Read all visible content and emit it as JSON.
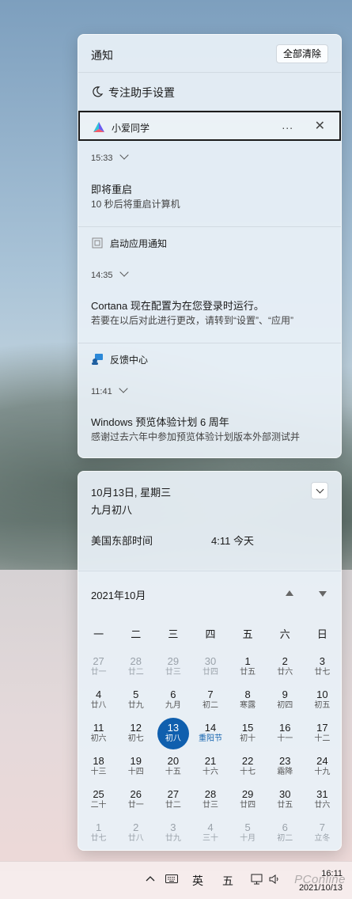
{
  "notification_center": {
    "title": "通知",
    "clear_all": "全部清除",
    "focus_assist": "专注助手设置",
    "groups": [
      {
        "app": "小爱同学",
        "time": "15:33",
        "title": "即将重启",
        "body": "10 秒后将重启计算机"
      },
      {
        "app": "启动应用通知",
        "time": "14:35",
        "title": "Cortana 现在配置为在您登录时运行。",
        "body": "若要在以后对此进行更改，请转到“设置”、“应用”"
      },
      {
        "app": "反馈中心",
        "time": "11:41",
        "title": "Windows 预览体验计划 6 周年",
        "body": "感谢过去六年中参加预览体验计划版本外部测试并"
      }
    ],
    "more_icon": "...",
    "close_icon": "✕"
  },
  "calendar": {
    "date_line": "10月13日, 星期三",
    "lunar_line": "九月初八",
    "tz_name": "美国东部时间",
    "tz_time": "4:11 今天",
    "month_label": "2021年10月",
    "weekdays": [
      "一",
      "二",
      "三",
      "四",
      "五",
      "六",
      "日"
    ],
    "days": [
      {
        "d": "27",
        "l": "廿一",
        "dim": true
      },
      {
        "d": "28",
        "l": "廿二",
        "dim": true
      },
      {
        "d": "29",
        "l": "廿三",
        "dim": true
      },
      {
        "d": "30",
        "l": "廿四",
        "dim": true
      },
      {
        "d": "1",
        "l": "廿五"
      },
      {
        "d": "2",
        "l": "廿六"
      },
      {
        "d": "3",
        "l": "廿七"
      },
      {
        "d": "4",
        "l": "廿八"
      },
      {
        "d": "5",
        "l": "廿九"
      },
      {
        "d": "6",
        "l": "九月"
      },
      {
        "d": "7",
        "l": "初二"
      },
      {
        "d": "8",
        "l": "寒露"
      },
      {
        "d": "9",
        "l": "初四"
      },
      {
        "d": "10",
        "l": "初五"
      },
      {
        "d": "11",
        "l": "初六"
      },
      {
        "d": "12",
        "l": "初七"
      },
      {
        "d": "13",
        "l": "初八",
        "today": true
      },
      {
        "d": "14",
        "l": "重阳节",
        "fest": true
      },
      {
        "d": "15",
        "l": "初十"
      },
      {
        "d": "16",
        "l": "十一"
      },
      {
        "d": "17",
        "l": "十二"
      },
      {
        "d": "18",
        "l": "十三"
      },
      {
        "d": "19",
        "l": "十四"
      },
      {
        "d": "20",
        "l": "十五"
      },
      {
        "d": "21",
        "l": "十六"
      },
      {
        "d": "22",
        "l": "十七"
      },
      {
        "d": "23",
        "l": "霜降"
      },
      {
        "d": "24",
        "l": "十九"
      },
      {
        "d": "25",
        "l": "二十"
      },
      {
        "d": "26",
        "l": "廿一"
      },
      {
        "d": "27",
        "l": "廿二"
      },
      {
        "d": "28",
        "l": "廿三"
      },
      {
        "d": "29",
        "l": "廿四"
      },
      {
        "d": "30",
        "l": "廿五"
      },
      {
        "d": "31",
        "l": "廿六"
      },
      {
        "d": "1",
        "l": "廿七",
        "dim": true
      },
      {
        "d": "2",
        "l": "廿八",
        "dim": true
      },
      {
        "d": "3",
        "l": "廿九",
        "dim": true
      },
      {
        "d": "4",
        "l": "三十",
        "dim": true
      },
      {
        "d": "5",
        "l": "十月",
        "dim": true
      },
      {
        "d": "6",
        "l": "初二",
        "dim": true
      },
      {
        "d": "7",
        "l": "立冬",
        "dim": true
      }
    ]
  },
  "taskbar": {
    "ime_lang": "英",
    "ime_mode": "五",
    "time": "16:11",
    "date": "2021/10/13",
    "watermark": "PConline"
  },
  "colors": {
    "accent": "#0f5fae",
    "festival": "#1665b0"
  }
}
